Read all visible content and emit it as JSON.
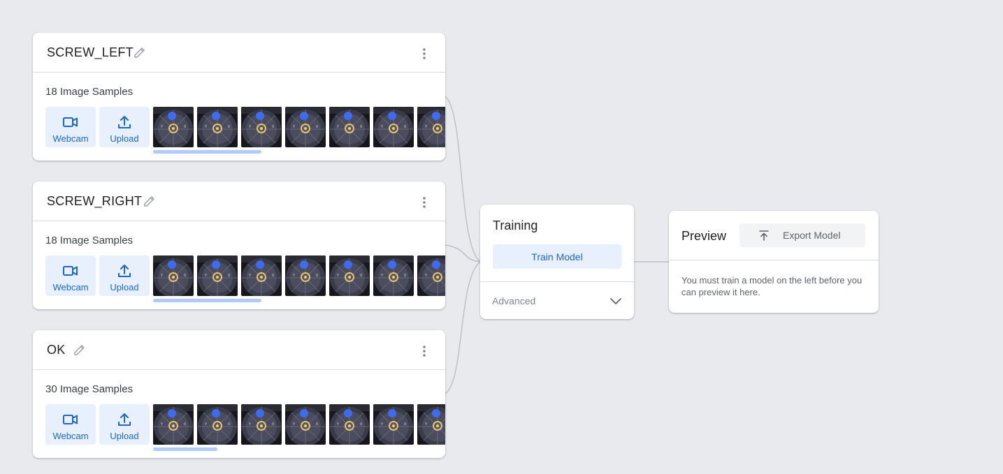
{
  "classes": [
    {
      "name": "SCREW_LEFT",
      "samples_label": "18 Image Samples",
      "webcam_label": "Webcam",
      "upload_label": "Upload",
      "icons": [
        "edit-icon",
        "more-vert-icon",
        "videocam-icon",
        "upload-icon"
      ],
      "scroll_fraction": 0.37
    },
    {
      "name": "SCREW_RIGHT",
      "samples_label": "18 Image Samples",
      "webcam_label": "Webcam",
      "upload_label": "Upload",
      "icons": [
        "edit-icon",
        "more-vert-icon",
        "videocam-icon",
        "upload-icon"
      ],
      "scroll_fraction": 0.37
    },
    {
      "name": "OK",
      "samples_label": "30 Image Samples",
      "webcam_label": "Webcam",
      "upload_label": "Upload",
      "icons": [
        "edit-icon",
        "more-vert-icon",
        "videocam-icon",
        "upload-icon"
      ],
      "scroll_fraction": 0.22
    }
  ],
  "training": {
    "title": "Training",
    "train_button": "Train Model",
    "advanced_label": "Advanced",
    "chevron_icon": "chevron-down-icon"
  },
  "preview": {
    "title": "Preview",
    "export_button": "Export Model",
    "export_icon": "export-icon",
    "message": "You must train a model on the left before you can preview it here."
  },
  "colors": {
    "background": "#e8eaed",
    "accent": "#1967d2",
    "accent_light": "#e8f0fe",
    "scroll": "#aecbfa",
    "connector": "#bdc1c6"
  }
}
